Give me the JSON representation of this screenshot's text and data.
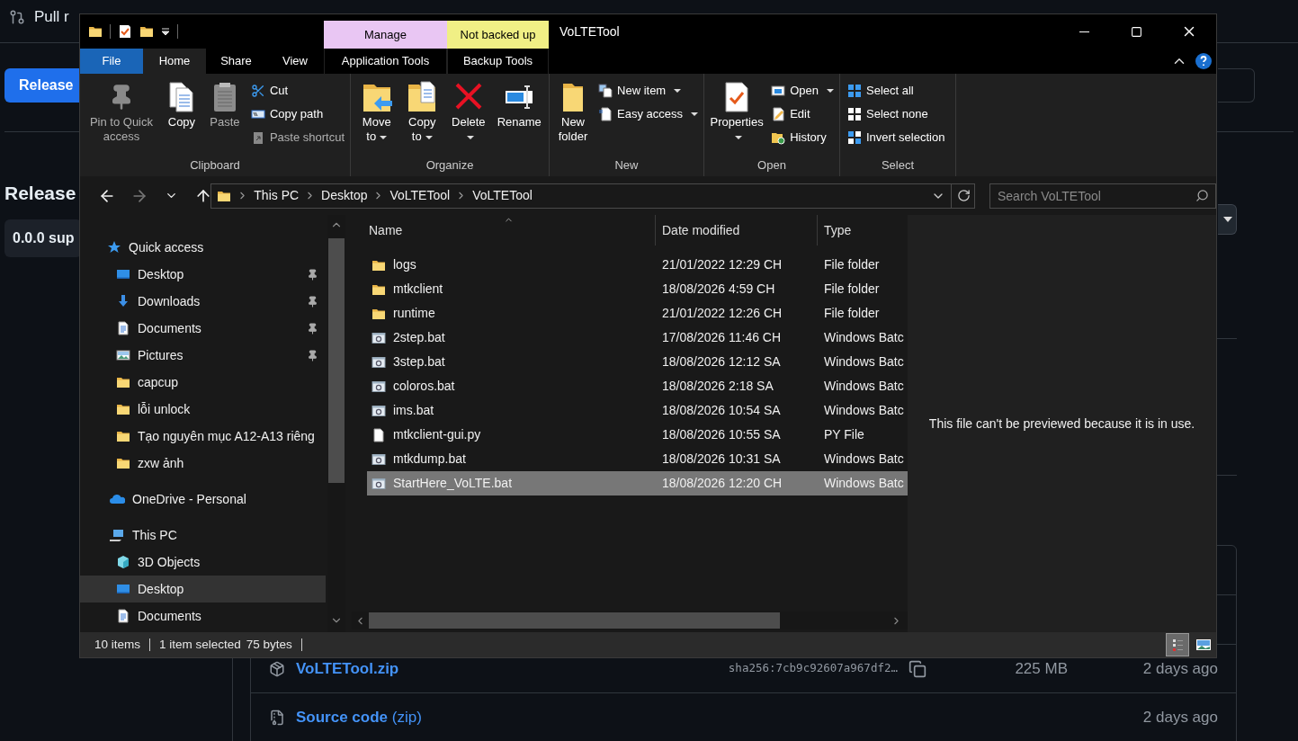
{
  "github_page": {
    "nav": [
      "Pull r"
    ],
    "releases_button": "Release",
    "heading": "Release",
    "tag": "0.0.0 sup",
    "assets": [
      {
        "kind": "zip",
        "name": "VoLTETool.zip",
        "hash": "sha256:7cb9c92607a967df2…",
        "size": "225 MB",
        "time": "2 days ago"
      },
      {
        "kind": "source",
        "name": "Source code",
        "suffix": "(zip)",
        "time": "2 days ago"
      }
    ]
  },
  "explorer": {
    "title": "VoLTETool",
    "context_tabs": [
      {
        "header": "Manage",
        "label": "Application Tools",
        "color": "#e9c6f3"
      },
      {
        "header": "Not backed up",
        "label": "Backup Tools",
        "color": "#f0ef85"
      }
    ],
    "tabs": [
      {
        "label": "File",
        "kind": "menu",
        "selected": false
      },
      {
        "label": "Home",
        "kind": "tab",
        "selected": true
      },
      {
        "label": "Share",
        "kind": "tab",
        "selected": false
      },
      {
        "label": "View",
        "kind": "tab",
        "selected": false
      }
    ],
    "ribbon": [
      {
        "label": "Clipboard",
        "large": [
          {
            "label": "Pin to Quick access",
            "dropdown": false,
            "disabled": true
          },
          {
            "label": "Copy",
            "dropdown": false,
            "disabled": false
          },
          {
            "label": "Paste",
            "dropdown": false,
            "disabled": true
          }
        ],
        "small": [
          {
            "label": "Cut",
            "dropdown": false,
            "disabled": false
          },
          {
            "label": "Copy path",
            "dropdown": false,
            "disabled": false
          },
          {
            "label": "Paste shortcut",
            "dropdown": false,
            "disabled": true
          }
        ]
      },
      {
        "label": "Organize",
        "large": [
          {
            "label": "Move to",
            "dropdown": true,
            "disabled": false
          },
          {
            "label": "Copy to",
            "dropdown": true,
            "disabled": false
          },
          {
            "label": "Delete",
            "dropdown": true,
            "disabled": false
          },
          {
            "label": "Rename",
            "dropdown": false,
            "disabled": false
          }
        ]
      },
      {
        "label": "New",
        "large": [
          {
            "label": "New folder",
            "dropdown": false,
            "disabled": false
          }
        ],
        "small": [
          {
            "label": "New item",
            "dropdown": true,
            "disabled": false
          },
          {
            "label": "Easy access",
            "dropdown": true,
            "disabled": false
          }
        ]
      },
      {
        "label": "Open",
        "large": [
          {
            "label": "Properties",
            "dropdown": true,
            "disabled": false
          }
        ],
        "small": [
          {
            "label": "Open",
            "dropdown": true,
            "disabled": false
          },
          {
            "label": "Edit",
            "dropdown": false,
            "disabled": false
          },
          {
            "label": "History",
            "dropdown": false,
            "disabled": false
          }
        ]
      },
      {
        "label": "Select",
        "small": [
          {
            "label": "Select all",
            "dropdown": false,
            "disabled": false
          },
          {
            "label": "Select none",
            "dropdown": false,
            "disabled": false
          },
          {
            "label": "Invert selection",
            "dropdown": false,
            "disabled": false
          }
        ]
      }
    ],
    "nav_buttons": [
      {
        "kind": "back",
        "disabled": false
      },
      {
        "kind": "forward",
        "disabled": true
      },
      {
        "kind": "recent",
        "disabled": false
      },
      {
        "kind": "up",
        "disabled": false
      }
    ],
    "address": [
      "This PC",
      "Desktop",
      "VoLTETool",
      "VoLTETool"
    ],
    "search": {
      "placeholder": "Search VoLTETool"
    },
    "nav_pane": [
      {
        "label": "Quick access",
        "kind": "star",
        "selected": false,
        "pinned": false,
        "children": [
          {
            "label": "Desktop",
            "kind": "desktop",
            "selected": false,
            "pinned": true
          },
          {
            "label": "Downloads",
            "kind": "download",
            "selected": false,
            "pinned": true
          },
          {
            "label": "Documents",
            "kind": "document",
            "selected": false,
            "pinned": true
          },
          {
            "label": "Pictures",
            "kind": "pictures",
            "selected": false,
            "pinned": true
          },
          {
            "label": "capcup",
            "kind": "folder",
            "selected": false,
            "pinned": false
          },
          {
            "label": "lỗi unlock",
            "kind": "folder",
            "selected": false,
            "pinned": false
          },
          {
            "label": "Tạo nguyên mục A12-A13 riêng",
            "kind": "folder",
            "selected": false,
            "pinned": false
          },
          {
            "label": "zxw ảnh",
            "kind": "folder",
            "selected": false,
            "pinned": false
          }
        ]
      },
      {
        "label": "OneDrive - Personal",
        "kind": "cloud",
        "selected": false,
        "pinned": false
      },
      {
        "label": "This PC",
        "kind": "pc",
        "selected": false,
        "pinned": false,
        "children": [
          {
            "label": "3D Objects",
            "kind": "cube",
            "selected": false,
            "pinned": false
          },
          {
            "label": "Desktop",
            "kind": "desktop",
            "selected": true,
            "pinned": false
          },
          {
            "label": "Documents",
            "kind": "document",
            "selected": false,
            "pinned": false
          }
        ]
      }
    ],
    "columns": [
      "Name",
      "Date modified",
      "Type"
    ],
    "files": [
      {
        "name": "logs",
        "date": "21/01/2022 12:29 CH",
        "type": "File folder",
        "kind": "folder",
        "selected": false
      },
      {
        "name": "mtkclient",
        "date": "18/08/2026 4:59 CH",
        "type": "File folder",
        "kind": "folder",
        "selected": false
      },
      {
        "name": "runtime",
        "date": "21/01/2022 12:26 CH",
        "type": "File folder",
        "kind": "folder",
        "selected": false
      },
      {
        "name": "2step.bat",
        "date": "17/08/2026 11:46 CH",
        "type": "Windows Batc",
        "kind": "batch",
        "selected": false
      },
      {
        "name": "3step.bat",
        "date": "18/08/2026 12:12 SA",
        "type": "Windows Batc",
        "kind": "batch",
        "selected": false
      },
      {
        "name": "coloros.bat",
        "date": "18/08/2026 2:18 SA",
        "type": "Windows Batc",
        "kind": "batch",
        "selected": false
      },
      {
        "name": "ims.bat",
        "date": "18/08/2026 10:54 SA",
        "type": "Windows Batc",
        "kind": "batch",
        "selected": false
      },
      {
        "name": "mtkclient-gui.py",
        "date": "18/08/2026 10:55 SA",
        "type": "PY File",
        "kind": "file",
        "selected": false
      },
      {
        "name": "mtkdump.bat",
        "date": "18/08/2026 10:31 SA",
        "type": "Windows Batc",
        "kind": "batch",
        "selected": false
      },
      {
        "name": "StartHere_VoLTE.bat",
        "date": "18/08/2026 12:20 CH",
        "type": "Windows Batc",
        "kind": "batch",
        "selected": true
      }
    ],
    "preview": "This file can't be previewed because it is in use.",
    "status": [
      "10 items",
      "1 item selected",
      "75 bytes"
    ],
    "views": [
      {
        "kind": "details",
        "selected": true
      },
      {
        "kind": "thumbnails",
        "selected": false
      }
    ]
  }
}
